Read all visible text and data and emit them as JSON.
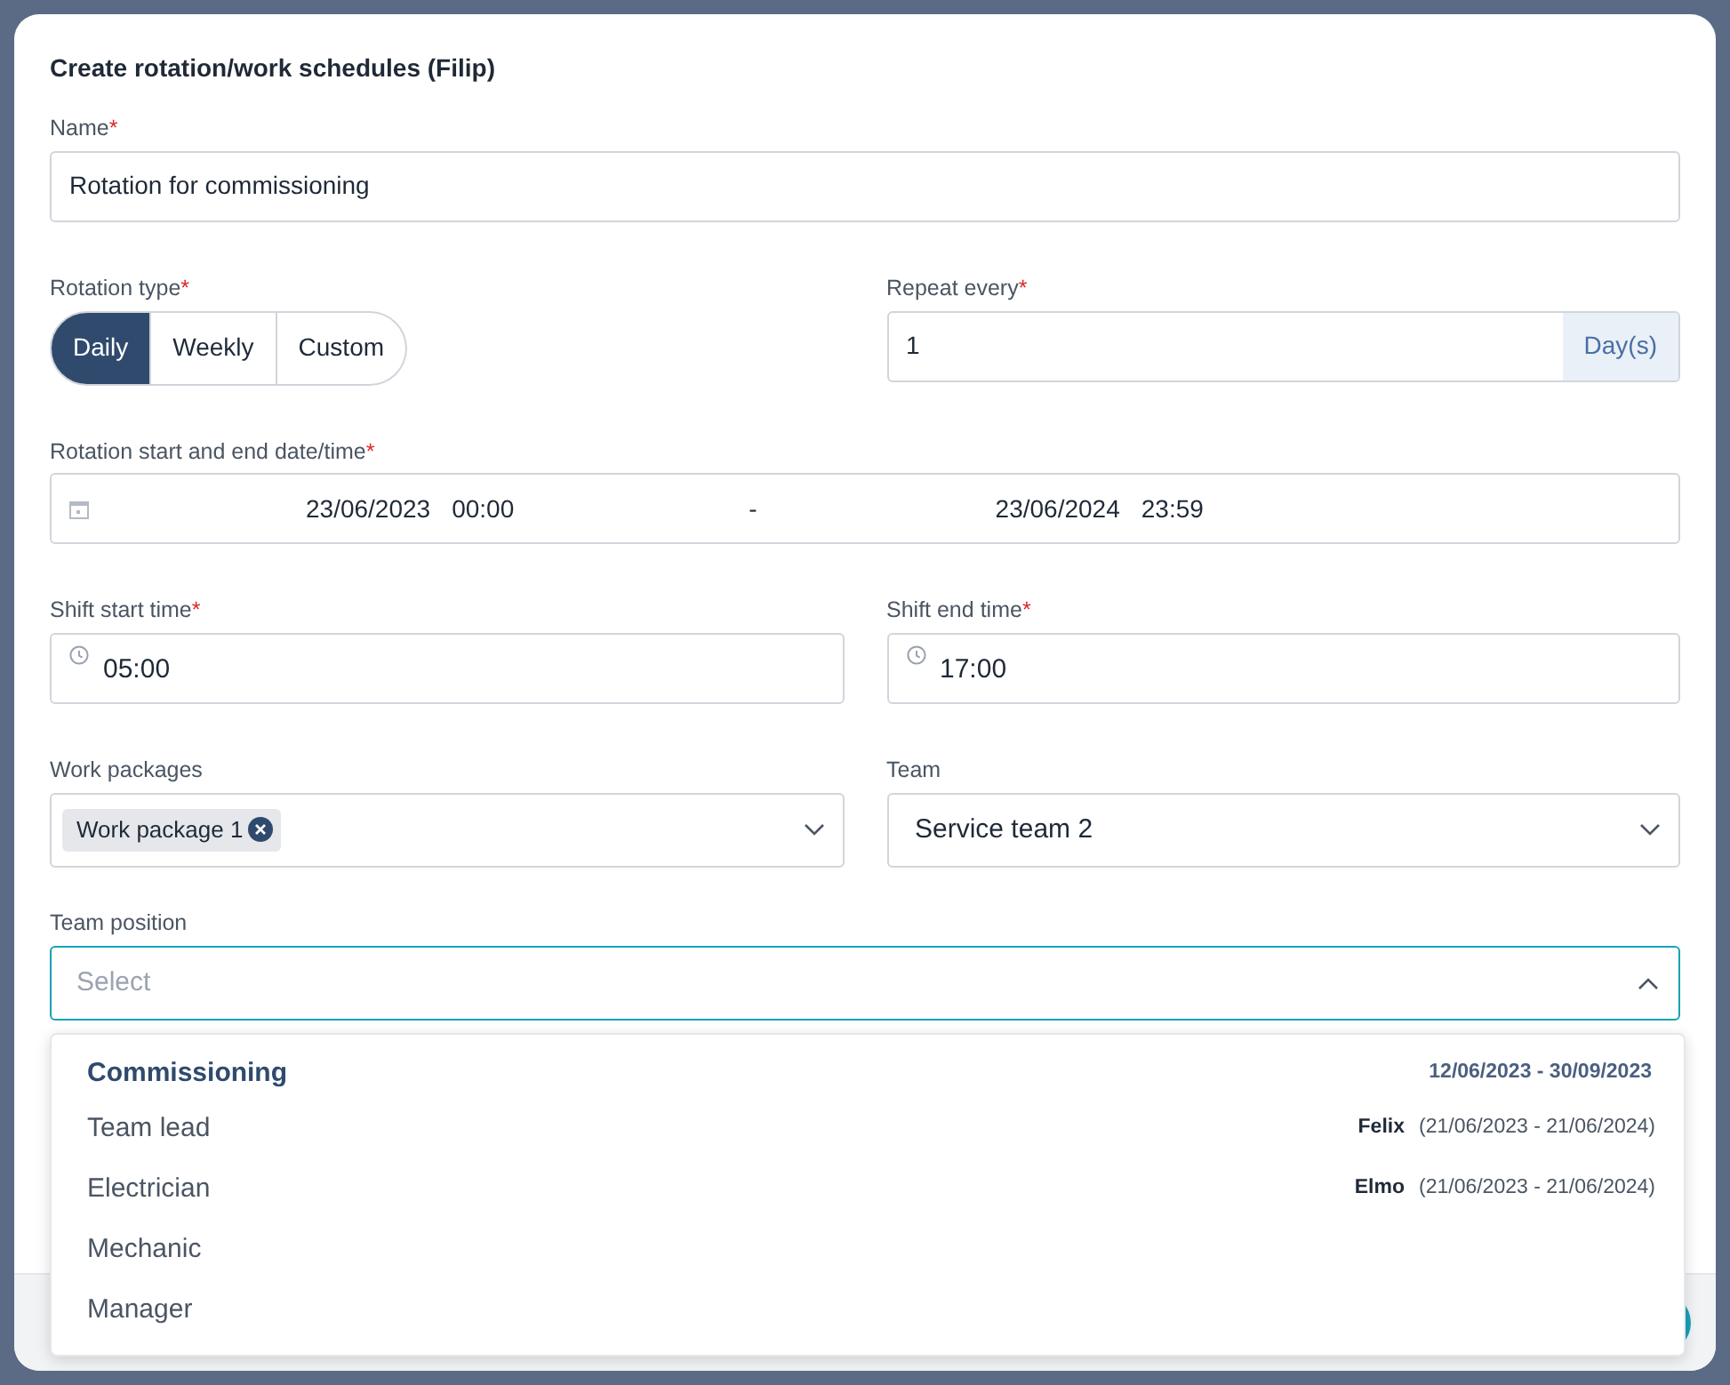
{
  "dialog": {
    "title": "Create rotation/work schedules (Filip)"
  },
  "name_field": {
    "label": "Name",
    "required_mark": "*",
    "value": "Rotation for commissioning"
  },
  "rotation_type": {
    "label": "Rotation type",
    "required_mark": "*",
    "options": [
      {
        "label": "Daily",
        "selected": true
      },
      {
        "label": "Weekly",
        "selected": false
      },
      {
        "label": "Custom",
        "selected": false
      }
    ]
  },
  "repeat_every": {
    "label": "Repeat every",
    "required_mark": "*",
    "value": "1",
    "unit": "Day(s)"
  },
  "date_range": {
    "label": "Rotation start and end date/time",
    "required_mark": "*",
    "start_date": "23/06/2023",
    "start_time": "00:00",
    "separator": "-",
    "end_date": "23/06/2024",
    "end_time": "23:59"
  },
  "shift_start": {
    "label": "Shift start time",
    "required_mark": "*",
    "value": "05:00"
  },
  "shift_end": {
    "label": "Shift end time",
    "required_mark": "*",
    "value": "17:00"
  },
  "work_packages": {
    "label": "Work packages",
    "tags": [
      "Work package 1"
    ]
  },
  "team": {
    "label": "Team",
    "value": "Service team 2"
  },
  "team_position": {
    "label": "Team position",
    "placeholder": "Select",
    "expanded": true
  },
  "dropdown": {
    "group": "Commissioning",
    "group_dates": "12/06/2023 - 30/09/2023",
    "options": [
      {
        "label": "Team lead",
        "person": "Felix",
        "period": "(21/06/2023 - 21/06/2024)"
      },
      {
        "label": "Electrician",
        "person": "Elmo",
        "period": "(21/06/2023 - 21/06/2024)"
      },
      {
        "label": "Mechanic"
      },
      {
        "label": "Manager"
      }
    ]
  }
}
